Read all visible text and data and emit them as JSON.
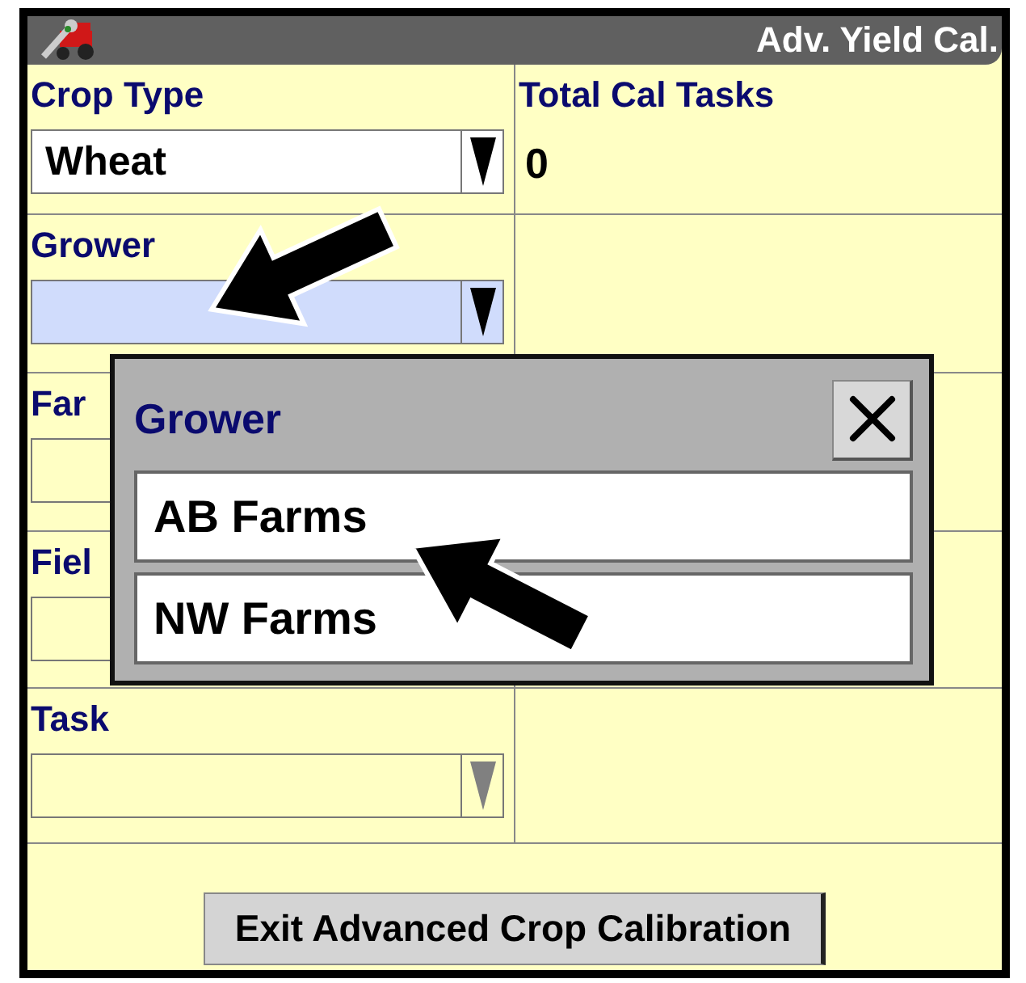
{
  "title_bar": {
    "title": "Adv. Yield Cal."
  },
  "fields": [
    {
      "label": "Crop Type",
      "value": "Wheat",
      "highlighted": false,
      "disabled": false
    },
    {
      "label": "Grower",
      "highlighted": true,
      "disabled": false
    },
    {
      "label": "Far",
      "highlighted": false,
      "disabled": true
    },
    {
      "label": "Fiel",
      "highlighted": false,
      "disabled": true
    },
    {
      "label": "Task",
      "highlighted": false,
      "disabled": true
    }
  ],
  "total_cal_tasks": {
    "label": "Total Cal Tasks",
    "value": "0"
  },
  "popup": {
    "title": "Grower",
    "items": [
      {
        "label": "AB Farms"
      },
      {
        "label": "NW Farms"
      }
    ]
  },
  "exit_button": {
    "label": "Exit Advanced Crop Calibration"
  }
}
